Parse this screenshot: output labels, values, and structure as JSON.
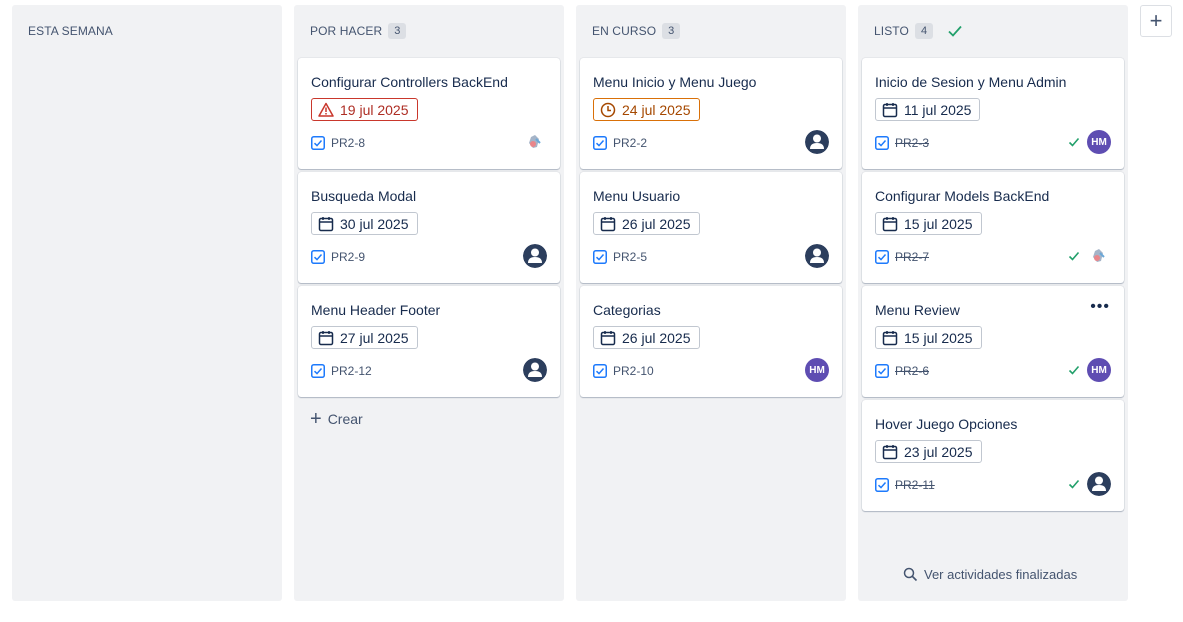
{
  "columns": [
    {
      "title": "ESTA SEMANA",
      "count": ""
    },
    {
      "title": "POR HACER",
      "count": "3",
      "cards": [
        {
          "title": "Configurar Controllers BackEnd",
          "date": "19 jul 2025",
          "date_state": "overdue",
          "key": "PR2-8",
          "assignee": "custom-avatar"
        },
        {
          "title": "Busqueda Modal",
          "date": "30 jul 2025",
          "date_state": "normal",
          "key": "PR2-9",
          "assignee": "default-user"
        },
        {
          "title": "Menu Header Footer",
          "date": "27 jul 2025",
          "date_state": "normal",
          "key": "PR2-12",
          "assignee": "default-user"
        }
      ],
      "create_label": "Crear"
    },
    {
      "title": "EN CURSO",
      "count": "3",
      "cards": [
        {
          "title": "Menu Inicio y Menu Juego",
          "date": "24 jul 2025",
          "date_state": "due-soon",
          "key": "PR2-2",
          "assignee": "default-user"
        },
        {
          "title": "Menu Usuario",
          "date": "26 jul 2025",
          "date_state": "normal",
          "key": "PR2-5",
          "assignee": "default-user"
        },
        {
          "title": "Categorias",
          "date": "26 jul 2025",
          "date_state": "normal",
          "key": "PR2-10",
          "assignee": "HM"
        }
      ]
    },
    {
      "title": "LISTO",
      "count": "4",
      "cards": [
        {
          "title": "Inicio de Sesion y Menu Admin",
          "date": "11 jul 2025",
          "date_state": "normal",
          "key": "PR2-3",
          "assignee": "HM"
        },
        {
          "title": "Configurar Models BackEnd",
          "date": "15 jul 2025",
          "date_state": "normal",
          "key": "PR2-7",
          "assignee": "custom-avatar"
        },
        {
          "title": "Menu Review",
          "date": "15 jul 2025",
          "date_state": "normal",
          "key": "PR2-6",
          "assignee": "HM"
        },
        {
          "title": "Hover Juego Opciones",
          "date": "23 jul 2025",
          "date_state": "normal",
          "key": "PR2-11",
          "assignee": "default-user"
        }
      ],
      "footer_link": "Ver actividades finalizadas"
    }
  ],
  "avatar_initials": "HM",
  "add_column_label": "+",
  "more_label": "•••",
  "colors": {
    "overdue": "#c9372c",
    "due_soon": "#d97008",
    "done_check": "#22a06b",
    "avatar_hm": "#5e4db2",
    "task_icon": "#1d7afc"
  }
}
